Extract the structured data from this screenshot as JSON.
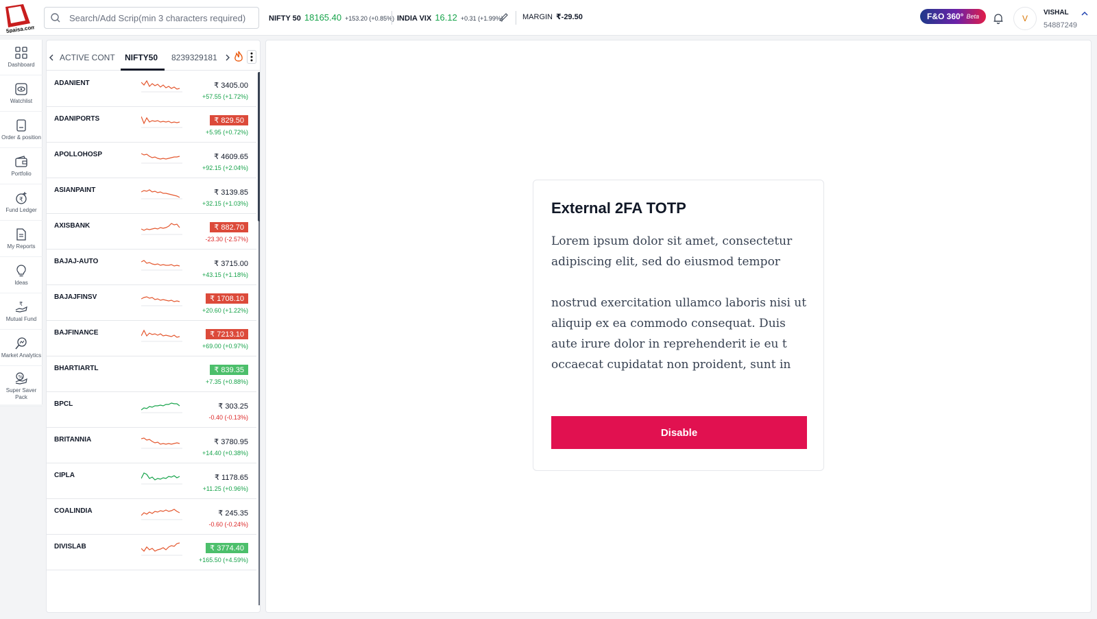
{
  "header": {
    "logo_text": "5paisa.com",
    "search_placeholder": "Search/Add Scrip(min 3 characters required)",
    "nifty": {
      "name": "NIFTY 50",
      "value": "18165.40",
      "change": "+153.20 (+0.85%)"
    },
    "vix": {
      "name": "INDIA VIX",
      "value": "16.12",
      "change": "+0.31 (+1.99%)"
    },
    "margin": {
      "label": "MARGIN",
      "value": "₹-29.50"
    },
    "fo_badge": {
      "label": "F&O 360°",
      "beta": "Beta"
    },
    "user": {
      "initial": "V",
      "name": "VISHAL",
      "id": "54887249"
    }
  },
  "sidenav": {
    "items": [
      {
        "label": "Dashboard",
        "icon": "grid-icon"
      },
      {
        "label": "Watchlist",
        "icon": "eye-icon"
      },
      {
        "label": "Order & position",
        "icon": "order-icon"
      },
      {
        "label": "Portfolio",
        "icon": "wallet-icon"
      },
      {
        "label": "Fund Ledger",
        "icon": "rupee-plus-icon"
      },
      {
        "label": "My Reports",
        "icon": "report-icon"
      },
      {
        "label": "Ideas",
        "icon": "bulb-icon"
      },
      {
        "label": "Mutual Fund",
        "icon": "hand-rupee-icon"
      },
      {
        "label": "Market Analytics",
        "icon": "analytics-icon"
      },
      {
        "label": "Super Saver Pack",
        "icon": "saver-icon"
      }
    ]
  },
  "watchlist": {
    "tabs": [
      "ACTIVE CONT",
      "NIFTY50",
      "8239329181"
    ],
    "rows": [
      {
        "symbol": "ADANIENT",
        "price": "₹ 3405.00",
        "change": "+57.55 (+1.72%)",
        "dir": "up",
        "hl": "none",
        "spark": "red"
      },
      {
        "symbol": "ADANIPORTS",
        "price": "₹ 829.50",
        "change": "+5.95 (+0.72%)",
        "dir": "up",
        "hl": "red",
        "spark": "red"
      },
      {
        "symbol": "APOLLOHOSP",
        "price": "₹ 4609.65",
        "change": "+92.15 (+2.04%)",
        "dir": "up",
        "hl": "none",
        "spark": "red"
      },
      {
        "symbol": "ASIANPAINT",
        "price": "₹ 3139.85",
        "change": "+32.15 (+1.03%)",
        "dir": "up",
        "hl": "none",
        "spark": "red"
      },
      {
        "symbol": "AXISBANK",
        "price": "₹ 882.70",
        "change": "-23.30 (-2.57%)",
        "dir": "down",
        "hl": "red",
        "spark": "red"
      },
      {
        "symbol": "BAJAJ-AUTO",
        "price": "₹ 3715.00",
        "change": "+43.15 (+1.18%)",
        "dir": "up",
        "hl": "none",
        "spark": "red"
      },
      {
        "symbol": "BAJAJFINSV",
        "price": "₹ 1708.10",
        "change": "+20.60 (+1.22%)",
        "dir": "up",
        "hl": "red",
        "spark": "red"
      },
      {
        "symbol": "BAJFINANCE",
        "price": "₹ 7213.10",
        "change": "+69.00 (+0.97%)",
        "dir": "up",
        "hl": "red",
        "spark": "red"
      },
      {
        "symbol": "BHARTIARTL",
        "price": "₹ 839.35",
        "change": "+7.35 (+0.88%)",
        "dir": "up",
        "hl": "green",
        "spark": "none"
      },
      {
        "symbol": "BPCL",
        "price": "₹ 303.25",
        "change": "-0.40 (-0.13%)",
        "dir": "down",
        "hl": "none",
        "spark": "green"
      },
      {
        "symbol": "BRITANNIA",
        "price": "₹ 3780.95",
        "change": "+14.40 (+0.38%)",
        "dir": "up",
        "hl": "none",
        "spark": "red"
      },
      {
        "symbol": "CIPLA",
        "price": "₹ 1178.65",
        "change": "+11.25 (+0.96%)",
        "dir": "up",
        "hl": "none",
        "spark": "green"
      },
      {
        "symbol": "COALINDIA",
        "price": "₹ 245.35",
        "change": "-0.60 (-0.24%)",
        "dir": "down",
        "hl": "none",
        "spark": "red"
      },
      {
        "symbol": "DIVISLAB",
        "price": "₹ 3774.40",
        "change": "+165.50 (+4.59%)",
        "dir": "up",
        "hl": "green",
        "spark": "red"
      }
    ]
  },
  "card": {
    "title": "External 2FA TOTP",
    "para1": "Lorem ipsum dolor sit amet, consectetur adipiscing elit, sed do eiusmod tempor",
    "para2": "nostrud exercitation ullamco laboris nisi ut aliquip ex ea commodo consequat. Duis aute irure dolor in reprehenderit ie eu t occaecat cupidatat non proident, sunt in",
    "button": "Disable"
  },
  "colors": {
    "accent": "#e11150",
    "up": "#16a34a",
    "down": "#dc2626",
    "hl_red": "#dc4a3a",
    "hl_green": "#4cbf6b"
  }
}
